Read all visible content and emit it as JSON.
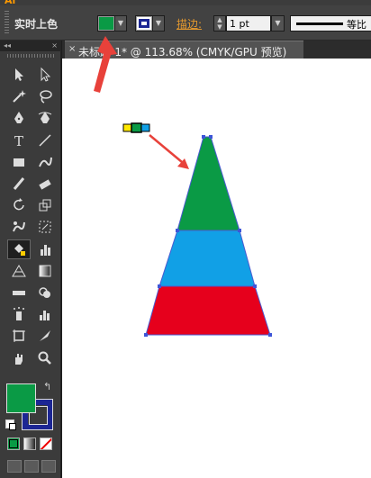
{
  "control_bar": {
    "label": "实时上色",
    "fill_color": "#0a9a45",
    "stroke_color": "#1c2693",
    "stroke_label": "描边",
    "stroke_colon": ":",
    "stroke_weight": "1 pt",
    "line_preset": "等比"
  },
  "document": {
    "tab_title": "未标题-1* @ 113.68% (CMYK/GPU 预览)"
  },
  "tools": {
    "fill": "#0a9a45",
    "stroke": "#1c2693",
    "icons": [
      "selection-icon",
      "direct-selection-icon",
      "magic-wand-icon",
      "lasso-icon",
      "pen-icon",
      "curvature-icon",
      "type-icon",
      "line-segment-icon",
      "rectangle-icon",
      "shaper-icon",
      "paintbrush-icon",
      "eraser-icon",
      "rotate-icon",
      "scale-icon",
      "warp-icon",
      "free-transform-icon",
      "live-paint-bucket-icon",
      "graph-icon",
      "perspective-grid-icon",
      "gradient-icon",
      "ruler-measure-icon",
      "shape-builder-icon",
      "symbol-sprayer-icon",
      "column-graph-icon",
      "artboard-icon",
      "slice-icon",
      "hand-icon",
      "zoom-icon"
    ]
  },
  "artwork": {
    "top_color": "#0a9a45",
    "middle_color": "#11a0e6",
    "bottom_color": "#e6001c",
    "swatch_cursor_colors": [
      "#ffe800",
      "#0a9a45",
      "#11a0e6"
    ]
  },
  "annotation_arrow_color": "#e8413a"
}
